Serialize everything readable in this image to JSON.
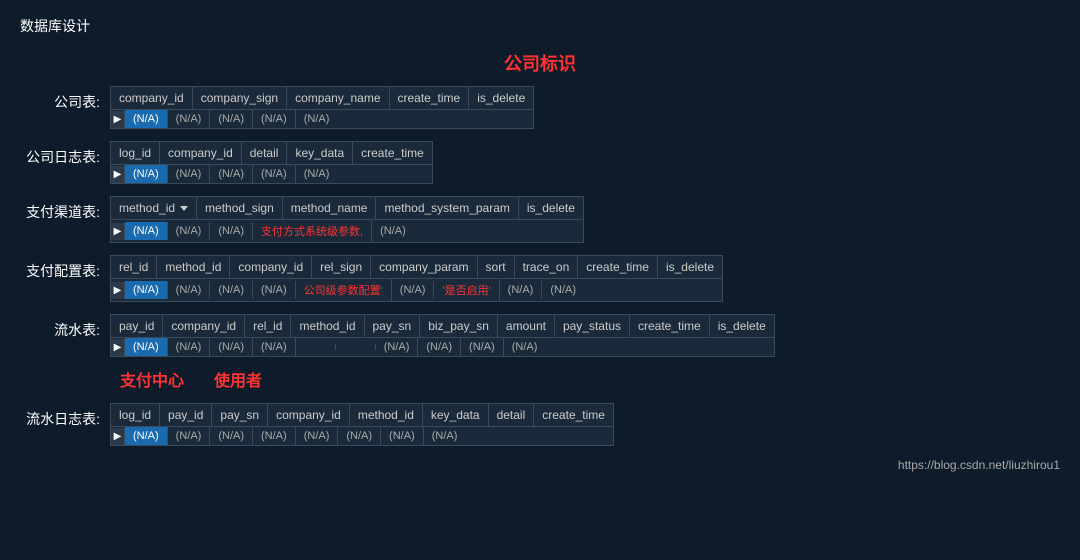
{
  "page": {
    "title": "数据库设计",
    "center_label": "公司标识",
    "footer_url": "https://blog.csdn.net/liuzhirou1"
  },
  "tables": [
    {
      "label": "公司表:",
      "columns": [
        "company_id",
        "company_sign",
        "company_name",
        "create_time",
        "is_delete"
      ],
      "rows": [
        {
          "cells": [
            "(N/A)",
            "(N/A)",
            "(N/A)",
            "(N/A)",
            "(N/A)"
          ],
          "highlighted": [
            0
          ]
        }
      ]
    },
    {
      "label": "公司日志表:",
      "columns": [
        "log_id",
        "company_id",
        "detail",
        "key_data",
        "create_time"
      ],
      "rows": [
        {
          "cells": [
            "(N/A)",
            "(N/A)",
            "(N/A)",
            "(N/A)",
            "(N/A)"
          ],
          "highlighted": [
            0
          ]
        }
      ]
    },
    {
      "label": "支付渠道表:",
      "columns": [
        "method_id",
        "method_sign",
        "method_name",
        "method_system_param",
        "is_delete"
      ],
      "col_arrow": [
        0
      ],
      "rows": [
        {
          "cells": [
            "(N/A)",
            "(N/A)",
            "(N/A)",
            "支付方式系统级参数,",
            "(N/A)"
          ],
          "highlighted": [
            0
          ],
          "red_cells": [
            3
          ]
        }
      ]
    },
    {
      "label": "支付配置表:",
      "columns": [
        "rel_id",
        "method_id",
        "company_id",
        "rel_sign",
        "company_param",
        "sort",
        "trace_on",
        "create_time",
        "is_delete"
      ],
      "rows": [
        {
          "cells": [
            "(N/A)",
            "(N/A)",
            "(N/A)",
            "(N/A)",
            "公司级参数配置'",
            "(N/A)",
            "'是否启用'",
            "(N/A)",
            "(N/A)"
          ],
          "highlighted": [
            0
          ],
          "red_cells": [
            4,
            6
          ]
        }
      ]
    },
    {
      "label": "流水表:",
      "columns": [
        "pay_id",
        "company_id",
        "rel_id",
        "method_id",
        "pay_sn",
        "biz_pay_sn",
        "amount",
        "pay_status",
        "create_time",
        "is_delete"
      ],
      "rows": [
        {
          "cells": [
            "(N/A)",
            "(N/A)",
            "(N/A)",
            "(N/A)",
            "",
            "",
            "(N/A)",
            "(N/A)",
            "(N/A)",
            "(N/A)"
          ],
          "highlighted": [
            0
          ]
        }
      ],
      "inline_labels": [
        "支付中心",
        "使用者"
      ]
    },
    {
      "label": "流水日志表:",
      "columns": [
        "log_id",
        "pay_id",
        "pay_sn",
        "company_id",
        "method_id",
        "key_data",
        "detail",
        "create_time"
      ],
      "rows": [
        {
          "cells": [
            "(N/A)",
            "(N/A)",
            "(N/A)",
            "(N/A)",
            "(N/A)",
            "(N/A)",
            "(N/A)",
            "(N/A)"
          ],
          "highlighted": [
            0
          ]
        }
      ]
    }
  ]
}
